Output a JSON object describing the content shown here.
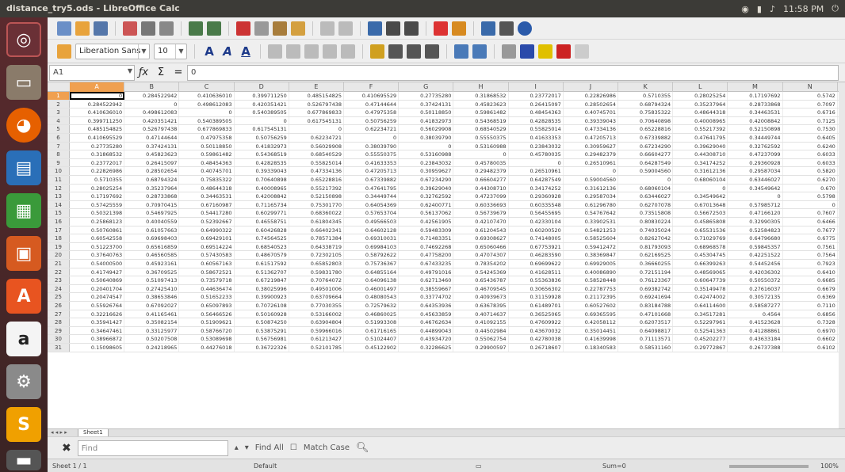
{
  "window": {
    "title": "distance_try5.ods - LibreOffice Calc",
    "tray_time": "11:58 PM"
  },
  "toolbar": {
    "font_name": "Liberation Sans",
    "font_size": "10"
  },
  "formula_bar": {
    "cell_ref": "A1",
    "content": "0"
  },
  "columns": [
    "A",
    "B",
    "C",
    "D",
    "E",
    "F",
    "G",
    "H",
    "I",
    "J",
    "K",
    "L",
    "M",
    "N"
  ],
  "rows": [
    [
      "0",
      "0.284522942",
      "0.410636010",
      "0.399711250",
      "0.485154825",
      "0.410695529",
      "0.27735280",
      "0.31868532",
      "0.23772017",
      "0.22826986",
      "0.5710355",
      "0.28025254",
      "0.17197692",
      "0.5742"
    ],
    [
      "0.284522942",
      "0",
      "0.498612083",
      "0.420351421",
      "0.526797438",
      "0.47144644",
      "0.37424131",
      "0.45823623",
      "0.26415097",
      "0.28502654",
      "0.68794324",
      "0.35237964",
      "0.28733868",
      "0.7097"
    ],
    [
      "0.410636010",
      "0.498612083",
      "0",
      "0.540389505",
      "0.677869833",
      "0.47975358",
      "0.50118850",
      "0.59861482",
      "0.48454363",
      "0.40745701",
      "0.75835322",
      "0.48644318",
      "0.34463531",
      "0.6716"
    ],
    [
      "0.399711250",
      "0.420351421",
      "0.540389505",
      "0",
      "0.617545131",
      "0.50756259",
      "0.41832973",
      "0.54368519",
      "0.42828535",
      "0.39339043",
      "0.70640898",
      "0.40008965",
      "0.42008842",
      "0.7125"
    ],
    [
      "0.485154825",
      "0.526797438",
      "0.677869833",
      "0.617545131",
      "0",
      "0.62234721",
      "0.56029908",
      "0.68540529",
      "0.55825014",
      "0.47334136",
      "0.65228816",
      "0.55217392",
      "0.52150898",
      "0.7530"
    ],
    [
      "0.410695529",
      "0.47144644",
      "0.47975358",
      "0.50756259",
      "0.62234721",
      "0",
      "0.38039790",
      "0.55550375",
      "0.41633353",
      "0.47205713",
      "0.67339882",
      "0.47641795",
      "0.34449744",
      "0.6405"
    ],
    [
      "0.27735280",
      "0.37424131",
      "0.50118850",
      "0.41832973",
      "0.56029908",
      "0.38039790",
      "0",
      "0.53160988",
      "0.23843032",
      "0.30959627",
      "0.67234290",
      "0.39629040",
      "0.32762592",
      "0.6240"
    ],
    [
      "0.31868532",
      "0.45823623",
      "0.59861482",
      "0.54368519",
      "0.68540529",
      "0.55550375",
      "0.53160988",
      "0",
      "0.45780035",
      "0.29482379",
      "0.66604277",
      "0.44308710",
      "0.47237099",
      "0.6033"
    ],
    [
      "0.23772017",
      "0.26415097",
      "0.48454363",
      "0.42828535",
      "0.55825014",
      "0.41633353",
      "0.23843032",
      "0.45780035",
      "0",
      "0.26510961",
      "0.64287549",
      "0.34174252",
      "0.29360928",
      "0.6033"
    ],
    [
      "0.22826986",
      "0.28502654",
      "0.40745701",
      "0.39339043",
      "0.47334136",
      "0.47205713",
      "0.30959627",
      "0.29482379",
      "0.26510961",
      "0",
      "0.59004560",
      "0.31612136",
      "0.29587034",
      "0.5820"
    ],
    [
      "0.5710355",
      "0.68794324",
      "0.75835322",
      "0.70640898",
      "0.65228816",
      "0.67339882",
      "0.67234290",
      "0.66604277",
      "0.64287549",
      "0.59004560",
      "0",
      "0.68060104",
      "0.63446027",
      "0.6270"
    ],
    [
      "0.28025254",
      "0.35237964",
      "0.48644318",
      "0.40008965",
      "0.55217392",
      "0.47641795",
      "0.39629040",
      "0.44308710",
      "0.34174252",
      "0.31612136",
      "0.68060104",
      "0",
      "0.34549642",
      "0.670"
    ],
    [
      "0.17197692",
      "0.28733868",
      "0.34463531",
      "0.42008842",
      "0.52150898",
      "0.34449744",
      "0.32762592",
      "0.47237099",
      "0.29360928",
      "0.29587034",
      "0.63446027",
      "0.34549642",
      "0",
      "0.5798"
    ],
    [
      "0.57425559",
      "0.70970415",
      "0.67160987",
      "0.71165734",
      "0.75301770",
      "0.64054369",
      "0.62400771",
      "0.60336693",
      "0.60335548",
      "0.61296780",
      "0.62707078",
      "0.67013648",
      "0.57985712",
      "0"
    ],
    [
      "0.50321398",
      "0.54697925",
      "0.54417280",
      "0.60299771",
      "0.68360022",
      "0.57653704",
      "0.56137062",
      "0.56739679",
      "0.56455695",
      "0.54767642",
      "0.73515808",
      "0.56672503",
      "0.47166120",
      "0.7607"
    ],
    [
      "0.25868123",
      "0.40040559",
      "0.52392667",
      "0.46558751",
      "0.61804345",
      "0.49566503",
      "0.42561905",
      "0.42107470",
      "0.42330104",
      "0.33902531",
      "0.80830224",
      "0.45865808",
      "0.32990305",
      "0.6466"
    ],
    [
      "0.50760861",
      "0.61057663",
      "0.64990322",
      "0.60426828",
      "0.66402341",
      "0.64602128",
      "0.59483309",
      "0.61204543",
      "0.60200520",
      "0.54821253",
      "0.74035024",
      "0.65531536",
      "0.52584823",
      "0.7677"
    ],
    [
      "0.60542558",
      "0.69698403",
      "0.69429101",
      "0.74564525",
      "0.78571384",
      "0.69310031",
      "0.71483351",
      "0.69308627",
      "0.74148005",
      "0.58525604",
      "0.82627042",
      "0.71029769",
      "0.64796680",
      "0.6775"
    ],
    [
      "0.51223700",
      "0.65616859",
      "0.69514224",
      "0.68540523",
      "0.64338719",
      "0.69984103",
      "0.74692268",
      "0.65060466",
      "0.67753921",
      "0.59412472",
      "0.81793093",
      "0.68968578",
      "0.59845357",
      "0.7561"
    ],
    [
      "0.37640763",
      "0.46560585",
      "0.57430583",
      "0.48670579",
      "0.72302105",
      "0.58792622",
      "0.47758200",
      "0.47074307",
      "0.46283590",
      "0.38369847",
      "0.62169525",
      "0.45304745",
      "0.42251522",
      "0.7564"
    ],
    [
      "0.54000500",
      "0.45923161",
      "0.60567163",
      "0.61517592",
      "0.65852803",
      "0.75736367",
      "0.67433235",
      "0.78354202",
      "0.69699622",
      "0.69929005",
      "0.36660255",
      "0.66399263",
      "0.54452456",
      "0.7923"
    ],
    [
      "0.41749427",
      "0.36709525",
      "0.58672521",
      "0.51362707",
      "0.59831780",
      "0.64855164",
      "0.49791016",
      "0.54245369",
      "0.41628511",
      "0.40086890",
      "0.72151194",
      "0.48569065",
      "0.42036302",
      "0.6410"
    ],
    [
      "0.50640869",
      "0.51097413",
      "0.73579718",
      "0.67219847",
      "0.70764072",
      "0.64096138",
      "0.62713460",
      "0.65436787",
      "0.55363836",
      "0.58528448",
      "0.76123367",
      "0.60647739",
      "0.50550372",
      "0.6685"
    ],
    [
      "0.20401704",
      "0.27425410",
      "0.44636474",
      "0.38025996",
      "0.49501006",
      "0.46001497",
      "0.38559667",
      "0.46709545",
      "0.30656302",
      "0.22787753",
      "0.69382742",
      "0.35149478",
      "0.27616037",
      "0.6679"
    ],
    [
      "0.20474547",
      "0.38653846",
      "0.51652233",
      "0.39900923",
      "0.63709664",
      "0.48080543",
      "0.33774702",
      "0.40939673",
      "0.31159928",
      "0.21172395",
      "0.69241694",
      "0.42474002",
      "0.30572135",
      "0.6369"
    ],
    [
      "0.55926764",
      "0.67092027",
      "0.65097893",
      "0.70726108",
      "0.77030355",
      "0.72579632",
      "0.64353936",
      "0.63678395",
      "0.61489701",
      "0.60527602",
      "0.83184788",
      "0.64114600",
      "0.58587277",
      "0.7110"
    ],
    [
      "0.32216626",
      "0.41165461",
      "0.56466526",
      "0.50160928",
      "0.53166002",
      "0.46860025",
      "0.45633859",
      "0.40714637",
      "0.36525065",
      "0.69365595",
      "0.47101668",
      "0.34517281",
      "0.4564",
      "0.6856"
    ],
    [
      "0.35941427",
      "0.35082154",
      "0.51909621",
      "0.50874250",
      "0.63904804",
      "0.51993308",
      "0.46762634",
      "0.41092155",
      "0.47609922",
      "0.42058112",
      "0.62073517",
      "0.52297961",
      "0.41523628",
      "0.7328"
    ],
    [
      "0.34647461",
      "0.33125977",
      "0.58766720",
      "0.53875291",
      "0.59966016",
      "0.61716165",
      "0.44899043",
      "0.44502984",
      "0.43670032",
      "0.35014451",
      "0.64098817",
      "0.52541363",
      "0.41288861",
      "0.6970"
    ],
    [
      "0.38966872",
      "0.50207508",
      "0.53089698",
      "0.56756981",
      "0.61213427",
      "0.51024407",
      "0.43934720",
      "0.55062754",
      "0.42780038",
      "0.41639998",
      "0.71113571",
      "0.45202277",
      "0.43633184",
      "0.6602"
    ],
    [
      "0.15098605",
      "0.24218965",
      "0.44276018",
      "0.36722326",
      "0.52101785",
      "0.45122902",
      "0.32286625",
      "0.29900597",
      "0.26718607",
      "0.18340583",
      "0.58531160",
      "0.29772867",
      "0.26737388",
      "0.6102"
    ]
  ],
  "sheet_tab": "Sheet1",
  "find": {
    "placeholder": "Find",
    "find_all": "Find All",
    "match_case": "Match Case"
  },
  "status": {
    "sheet": "Sheet 1 / 1",
    "style": "Default",
    "sum": "Sum=0",
    "zoom": "100%"
  }
}
